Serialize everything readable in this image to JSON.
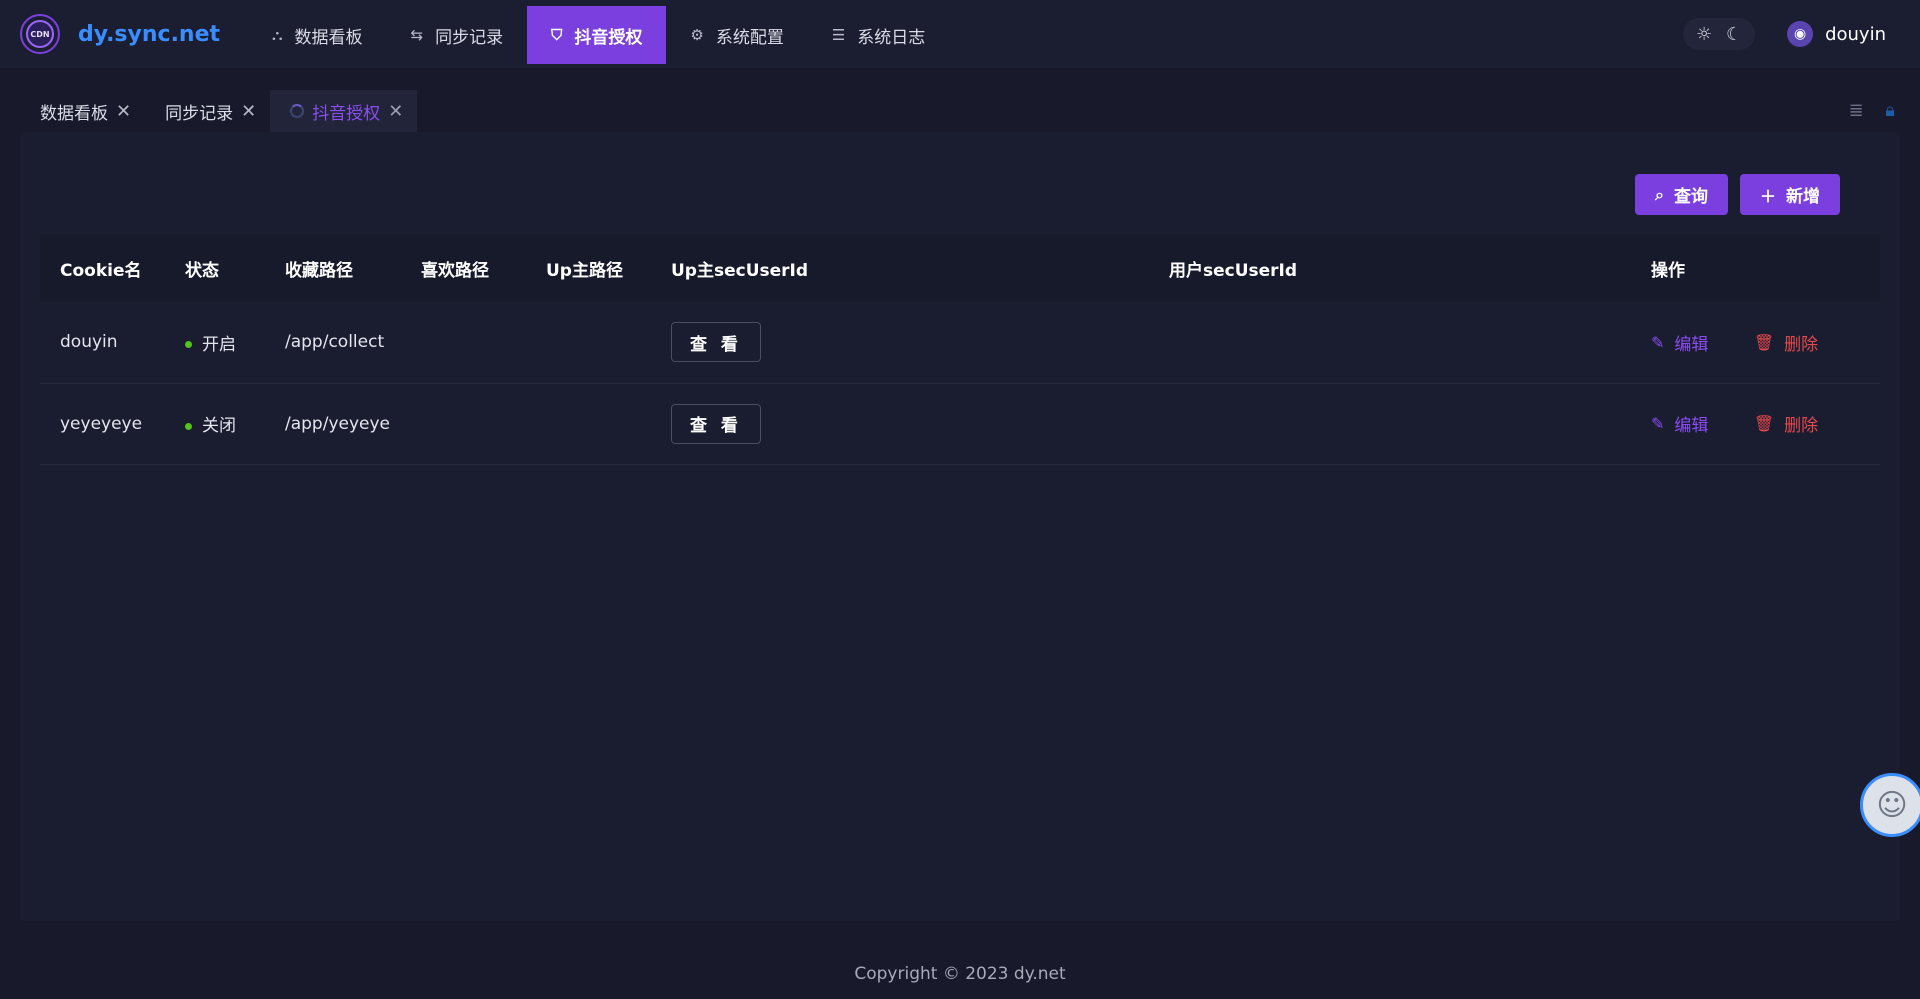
{
  "app": {
    "logo_text": "dy.sync.net",
    "logo_mark": "CDN"
  },
  "nav": [
    {
      "label": "数据看板",
      "icon": "dashboard-icon",
      "glyph": "⛬"
    },
    {
      "label": "同步记录",
      "icon": "sync-icon",
      "glyph": "⇆"
    },
    {
      "label": "抖音授权",
      "icon": "shield-icon",
      "glyph": "⛉"
    },
    {
      "label": "系统配置",
      "icon": "gear-icon",
      "glyph": "⚙"
    },
    {
      "label": "系统日志",
      "icon": "list-icon",
      "glyph": "☰"
    }
  ],
  "user": {
    "name": "douyin"
  },
  "tabs": [
    {
      "label": "数据看板"
    },
    {
      "label": "同步记录"
    },
    {
      "label": "抖音授权"
    }
  ],
  "toolbar": {
    "query_label": "查询",
    "add_label": "新增"
  },
  "table": {
    "headers": [
      "Cookie名",
      "状态",
      "收藏路径",
      "喜欢路径",
      "Up主路径",
      "Up主secUserId",
      "用户secUserId",
      "操作"
    ],
    "rows": [
      {
        "cookie": "douyin",
        "status": "开启",
        "collect_path": "/app/collect",
        "like_path": "",
        "up_path": "",
        "view_label": "查 看",
        "user_sec": "",
        "edit": "编辑",
        "delete": "删除"
      },
      {
        "cookie": "yeyeyeye",
        "status": "关闭",
        "collect_path": "/app/yeyeye",
        "like_path": "",
        "up_path": "",
        "view_label": "查 看",
        "user_sec": "",
        "edit": "编辑",
        "delete": "删除"
      }
    ]
  },
  "footer": {
    "copyright": "Copyright © 2023 dy.net"
  },
  "colors": {
    "accent": "#7b3fe0",
    "link": "#3a8dff",
    "success": "#52c41a",
    "danger": "#e5484d",
    "background": "#181a2c"
  }
}
